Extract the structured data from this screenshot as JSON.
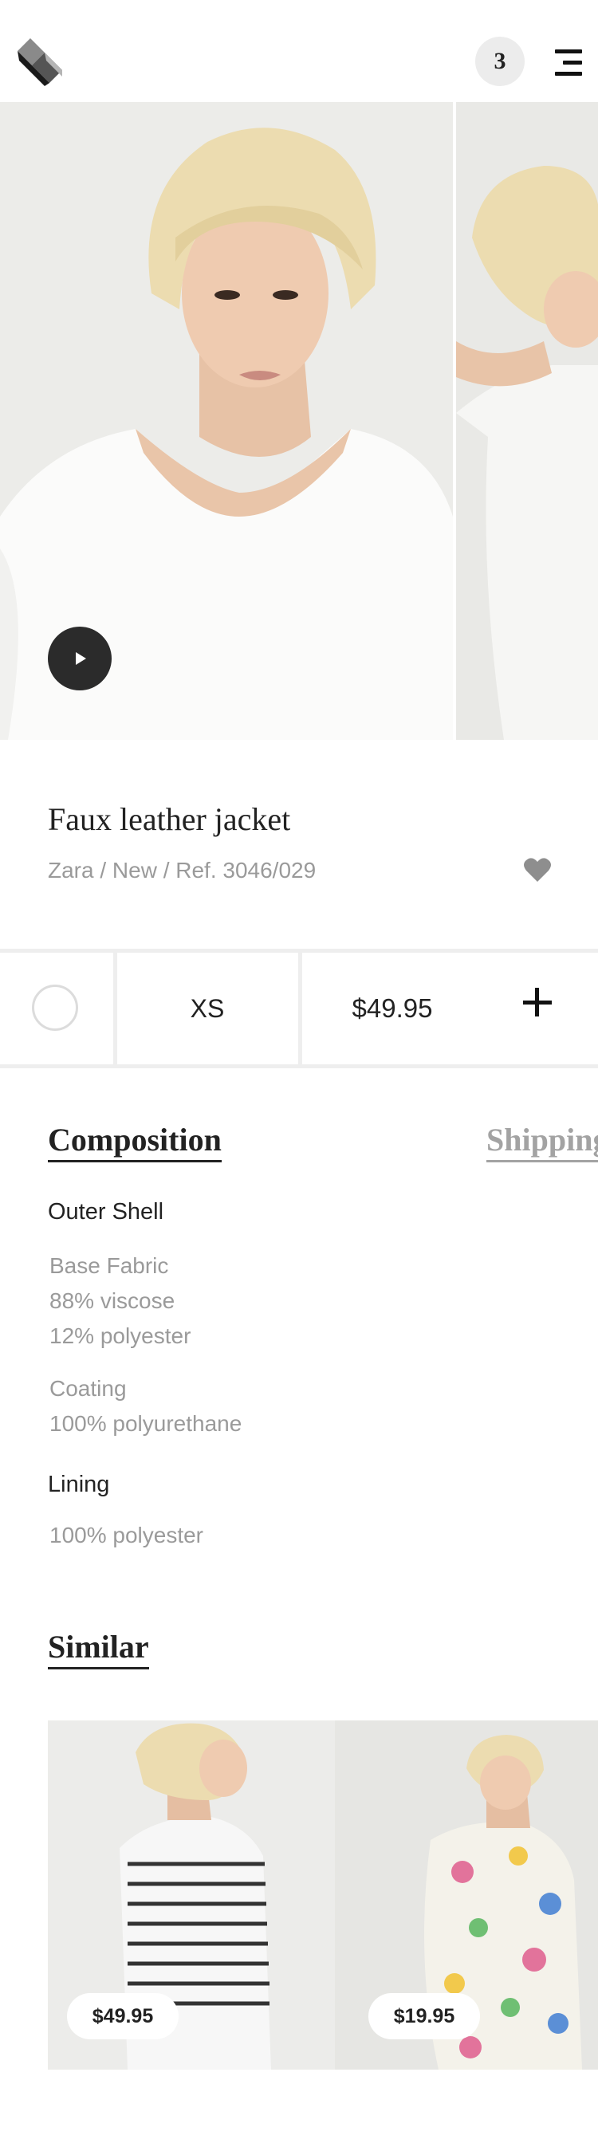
{
  "header": {
    "cart_count": "3"
  },
  "product": {
    "title": "Faux leather jacket",
    "meta": "Zara / New / Ref. 3046/029",
    "size": "XS",
    "price": "$49.95"
  },
  "tabs": [
    {
      "label": "Composition",
      "active": true
    },
    {
      "label": "Shipping",
      "active": false
    }
  ],
  "composition": {
    "outer_shell": {
      "heading": "Outer Shell",
      "groups": [
        {
          "lines": [
            "Base Fabric",
            "88% viscose",
            "12% polyester"
          ]
        },
        {
          "lines": [
            "Coating",
            "100% polyurethane"
          ]
        }
      ]
    },
    "lining": {
      "heading": "Lining",
      "lines": [
        "100% polyester"
      ]
    }
  },
  "similar": {
    "title": "Similar",
    "items": [
      {
        "price": "$49.95"
      },
      {
        "price": "$19.95"
      }
    ]
  },
  "colors": {
    "text": "#222222",
    "muted": "#9a9a9a",
    "divider": "#eeeeee",
    "badge": "#ececec",
    "play": "#2b2b2b"
  },
  "icons": [
    "logo-icon",
    "menu-icon",
    "play-icon",
    "heart-icon",
    "plus-icon"
  ]
}
